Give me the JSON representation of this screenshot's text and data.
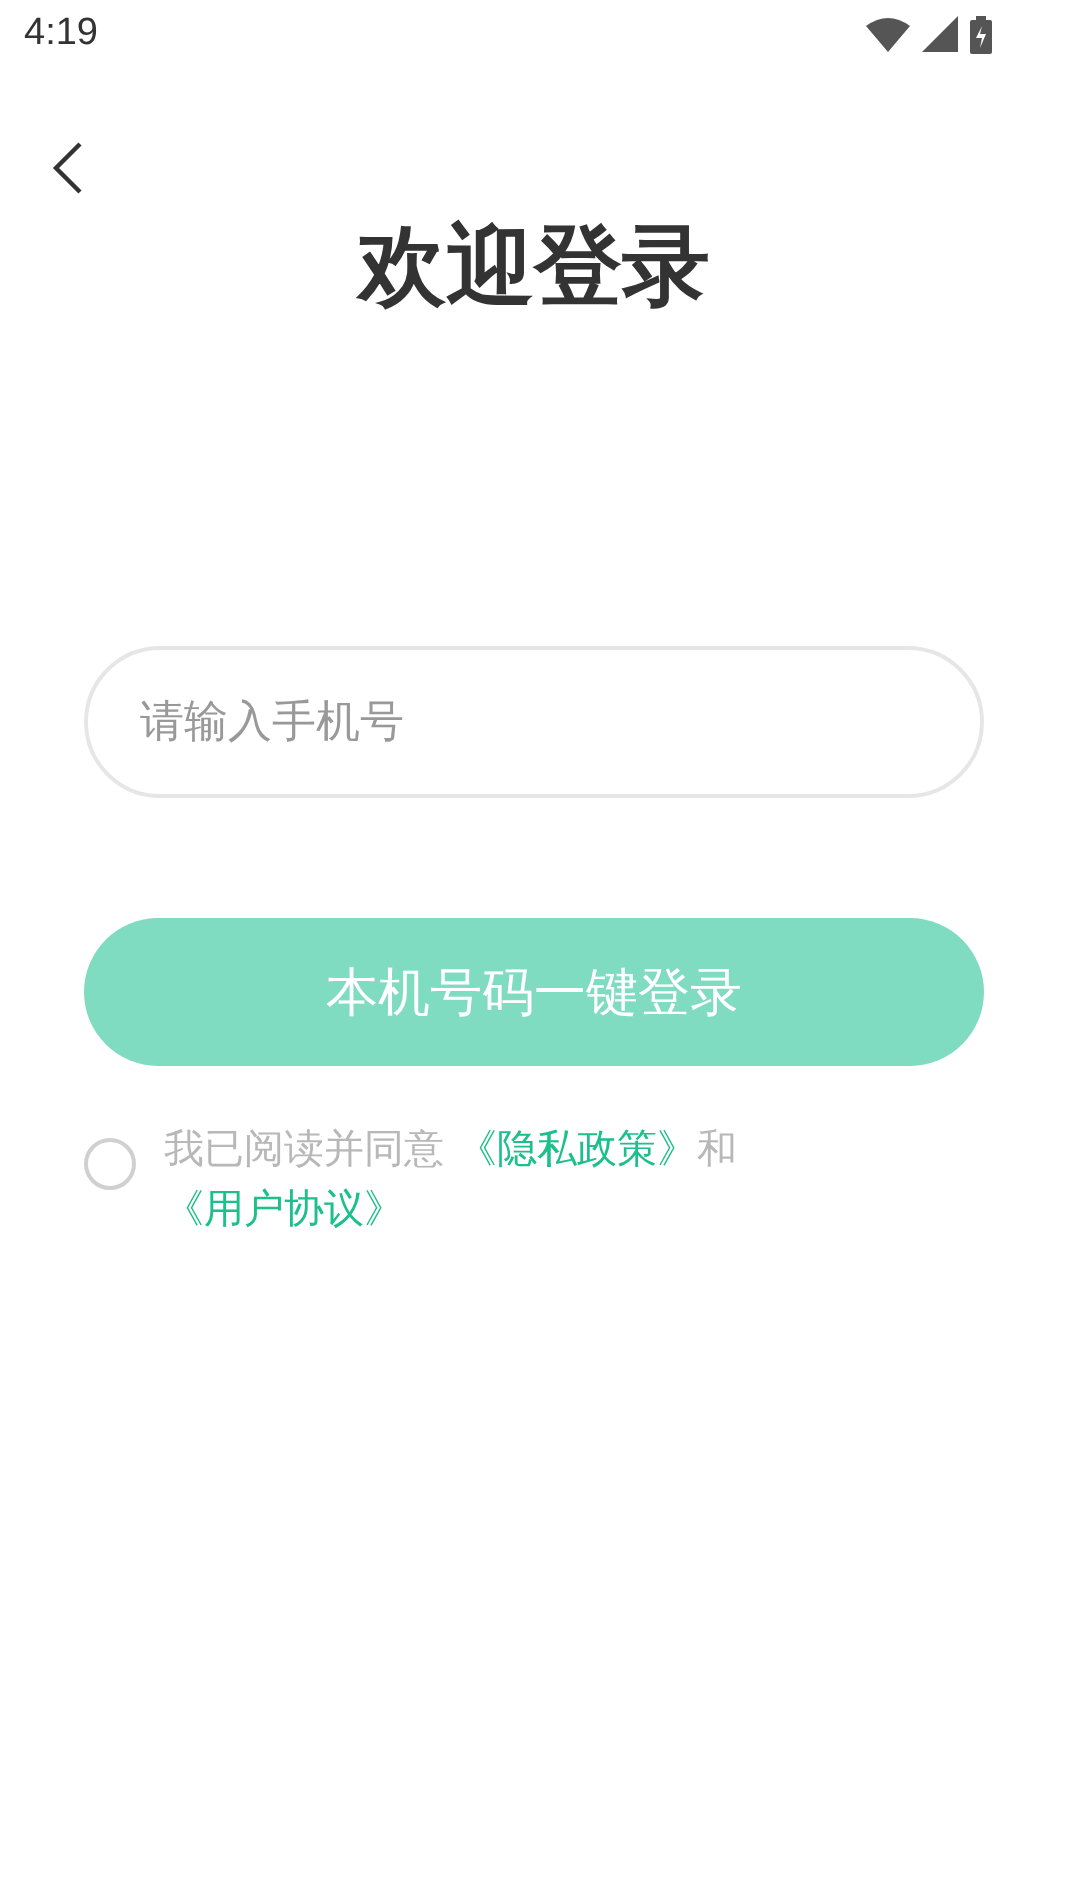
{
  "status_bar": {
    "time": "4:19"
  },
  "title": "欢迎登录",
  "phone_field": {
    "placeholder": "请输入手机号"
  },
  "login_button": {
    "label": "本机号码一键登录"
  },
  "agreement": {
    "agreed": false,
    "prefix": "我已阅读并同意 ",
    "privacy_link": "《隐私政策》",
    "joiner": "和",
    "terms_link": "《用户协议》"
  }
}
